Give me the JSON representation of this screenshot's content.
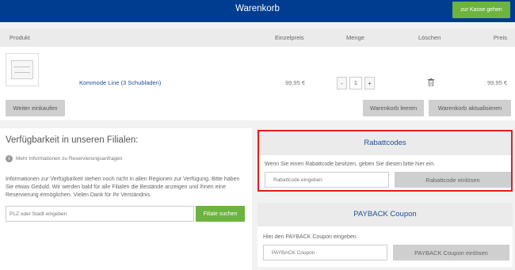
{
  "header": {
    "title": "Warenkorb",
    "checkout_label": "zur Kasse gehen"
  },
  "cart": {
    "columns": [
      "Produkt",
      "Einzelpreis",
      "Menge",
      "Löschen",
      "Preis"
    ],
    "item": {
      "name": "Kommode Line (3 Schubladen)",
      "unit_price": "99,95 €",
      "quantity": "1",
      "decrement": "-",
      "increment": "+",
      "total": "99,95 €",
      "delete_icon": "trash-icon"
    },
    "continue_label": "Weiter einkaufen",
    "clear_label": "Warenkorb leeren",
    "update_label": "Warenkorb aktualisieren"
  },
  "availability": {
    "title": "Verfügbarkeit in unseren Filialen:",
    "info_link": "Mehr Informationen zu Reservierungsanfragen",
    "info_icon": "info-icon",
    "text": "Informationen zur Verfügbarkeit stehen noch nicht in allen Regionen zur Verfügung. Bitte haben Sie etwas Geduld. Wir werden bald für alle Filialen die Bestände anzeigen und Ihnen eine Reservierung ermöglichen. Vielen Dank für Ihr Verständnis.",
    "input_placeholder": "PLZ oder Stadt eingeben",
    "search_label": "Filiale suchen"
  },
  "rabattcodes": {
    "title": "Rabattcodes",
    "text": "Wenn Sie einen Rabattcode besitzen, geben Sie diesen bitte hier ein.",
    "input_placeholder": "Rabattcode eingeben",
    "button_label": "Rabattcode einlösen"
  },
  "payback": {
    "title": "PAYBACK Coupon",
    "text": "Hier den PAYBACK Coupon eingeben.",
    "input_placeholder": "PAYBACK Coupon",
    "button_label": "PAYBACK Coupon einlösen"
  },
  "colors": {
    "header": "#003c8f",
    "accent_green": "#6cb33f",
    "highlight_border": "#e41c1c",
    "link_blue": "#1d4f91"
  }
}
